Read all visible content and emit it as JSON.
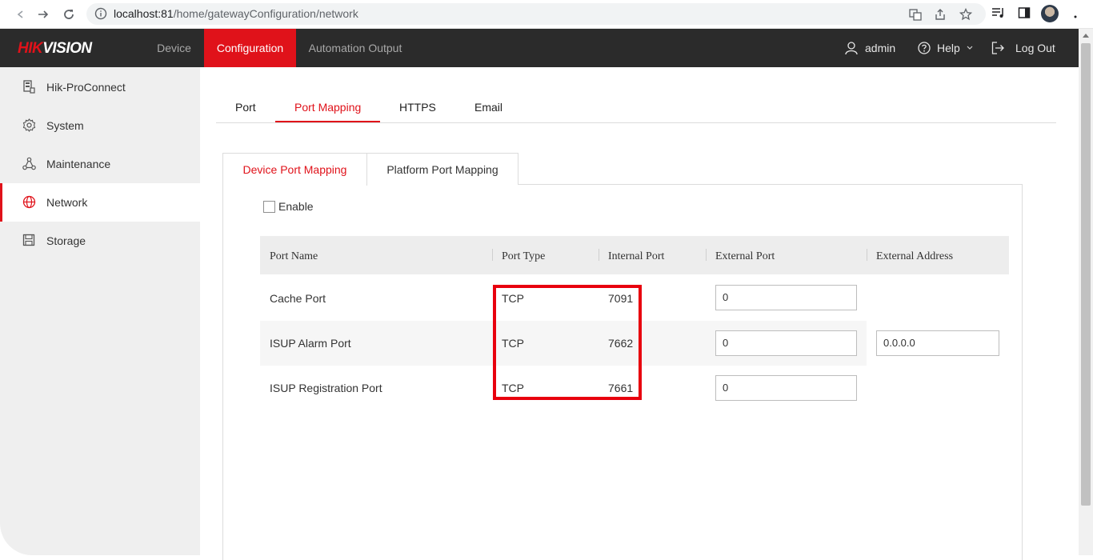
{
  "browser": {
    "url_host": "localhost:81",
    "url_path": "/home/gatewayConfiguration/network"
  },
  "header": {
    "logo_red": "HIK",
    "logo_white": "VISION",
    "nav": [
      {
        "label": "Device"
      },
      {
        "label": "Configuration"
      },
      {
        "label": "Automation Output"
      }
    ],
    "user": "admin",
    "help": "Help",
    "logout": "Log Out"
  },
  "sidebar": {
    "items": [
      {
        "label": "Hik-ProConnect",
        "icon": "device-icon"
      },
      {
        "label": "System",
        "icon": "gear-icon"
      },
      {
        "label": "Maintenance",
        "icon": "nodes-icon"
      },
      {
        "label": "Network",
        "icon": "globe-icon"
      },
      {
        "label": "Storage",
        "icon": "disk-icon"
      }
    ],
    "active": "Network"
  },
  "tabs": [
    "Port",
    "Port Mapping",
    "HTTPS",
    "Email"
  ],
  "active_tab": "Port Mapping",
  "subtabs": [
    "Device Port Mapping",
    "Platform Port Mapping"
  ],
  "active_subtab": "Device Port Mapping",
  "enable_label": "Enable",
  "enable_checked": false,
  "table": {
    "headers": [
      "Port Name",
      "Port Type",
      "Internal Port",
      "External Port",
      "External Address"
    ],
    "rows": [
      {
        "name": "Cache Port",
        "type": "TCP",
        "internal": "7091",
        "external": "0"
      },
      {
        "name": "ISUP Alarm Port",
        "type": "TCP",
        "internal": "7662",
        "external": "0"
      },
      {
        "name": "ISUP Registration Port",
        "type": "TCP",
        "internal": "7661",
        "external": "0"
      }
    ],
    "external_address": "0.0.0.0"
  },
  "colors": {
    "brand_red": "#e0121a",
    "header_bg": "#2b2b2b",
    "highlight": "#e8000e"
  }
}
